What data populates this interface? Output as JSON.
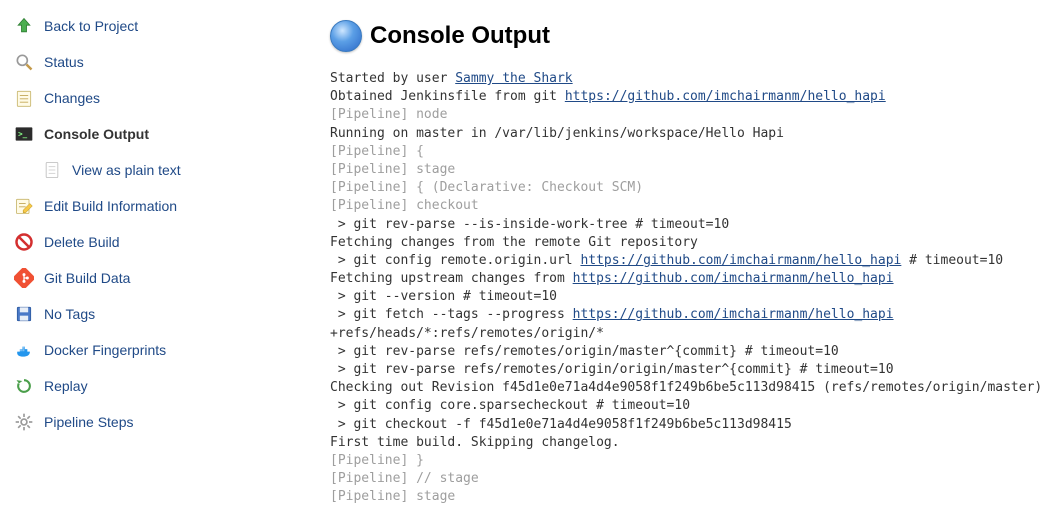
{
  "sidebar": {
    "items": [
      {
        "label": "Back to Project",
        "icon": "up-arrow-icon",
        "indent": false,
        "active": false
      },
      {
        "label": "Status",
        "icon": "magnifier-icon",
        "indent": false,
        "active": false
      },
      {
        "label": "Changes",
        "icon": "notepad-icon",
        "indent": false,
        "active": false
      },
      {
        "label": "Console Output",
        "icon": "terminal-icon",
        "indent": false,
        "active": true
      },
      {
        "label": "View as plain text",
        "icon": "document-icon",
        "indent": true,
        "active": false
      },
      {
        "label": "Edit Build Information",
        "icon": "edit-notepad-icon",
        "indent": false,
        "active": false
      },
      {
        "label": "Delete Build",
        "icon": "no-entry-icon",
        "indent": false,
        "active": false
      },
      {
        "label": "Git Build Data",
        "icon": "git-icon",
        "indent": false,
        "active": false
      },
      {
        "label": "No Tags",
        "icon": "save-icon",
        "indent": false,
        "active": false
      },
      {
        "label": "Docker Fingerprints",
        "icon": "docker-icon",
        "indent": false,
        "active": false
      },
      {
        "label": "Replay",
        "icon": "replay-icon",
        "indent": false,
        "active": false
      },
      {
        "label": "Pipeline Steps",
        "icon": "gear-icon",
        "indent": false,
        "active": false
      }
    ]
  },
  "page": {
    "title": "Console Output"
  },
  "console": {
    "user_link_label": "Sammy the Shark",
    "repo_link_label": "https://github.com/imchairmanm/hello_hapi",
    "lines": [
      {
        "text": "Started by user ",
        "type": "normal",
        "link": "user"
      },
      {
        "text": "Obtained Jenkinsfile from git ",
        "type": "normal",
        "link": "repo"
      },
      {
        "text": "[Pipeline] node",
        "type": "dim"
      },
      {
        "text": "Running on master in /var/lib/jenkins/workspace/Hello Hapi",
        "type": "normal"
      },
      {
        "text": "[Pipeline] {",
        "type": "dim"
      },
      {
        "text": "[Pipeline] stage",
        "type": "dim"
      },
      {
        "text": "[Pipeline] { (Declarative: Checkout SCM)",
        "type": "dim"
      },
      {
        "text": "[Pipeline] checkout",
        "type": "dim"
      },
      {
        "text": " > git rev-parse --is-inside-work-tree # timeout=10",
        "type": "normal"
      },
      {
        "text": "Fetching changes from the remote Git repository",
        "type": "normal"
      },
      {
        "text": " > git config remote.origin.url ",
        "type": "normal",
        "link": "repo",
        "suffix": " # timeout=10"
      },
      {
        "text": "Fetching upstream changes from ",
        "type": "normal",
        "link": "repo"
      },
      {
        "text": " > git --version # timeout=10",
        "type": "normal"
      },
      {
        "text": " > git fetch --tags --progress ",
        "type": "normal",
        "link": "repo"
      },
      {
        "text": "+refs/heads/*:refs/remotes/origin/*",
        "type": "normal"
      },
      {
        "text": " > git rev-parse refs/remotes/origin/master^{commit} # timeout=10",
        "type": "normal"
      },
      {
        "text": " > git rev-parse refs/remotes/origin/origin/master^{commit} # timeout=10",
        "type": "normal"
      },
      {
        "text": "Checking out Revision f45d1e0e71a4d4e9058f1f249b6be5c113d98415 (refs/remotes/origin/master)",
        "type": "normal"
      },
      {
        "text": " > git config core.sparsecheckout # timeout=10",
        "type": "normal"
      },
      {
        "text": " > git checkout -f f45d1e0e71a4d4e9058f1f249b6be5c113d98415",
        "type": "normal"
      },
      {
        "text": "First time build. Skipping changelog.",
        "type": "normal"
      },
      {
        "text": "[Pipeline] }",
        "type": "dim"
      },
      {
        "text": "[Pipeline] // stage",
        "type": "dim"
      },
      {
        "text": "[Pipeline] stage",
        "type": "dim"
      }
    ]
  }
}
